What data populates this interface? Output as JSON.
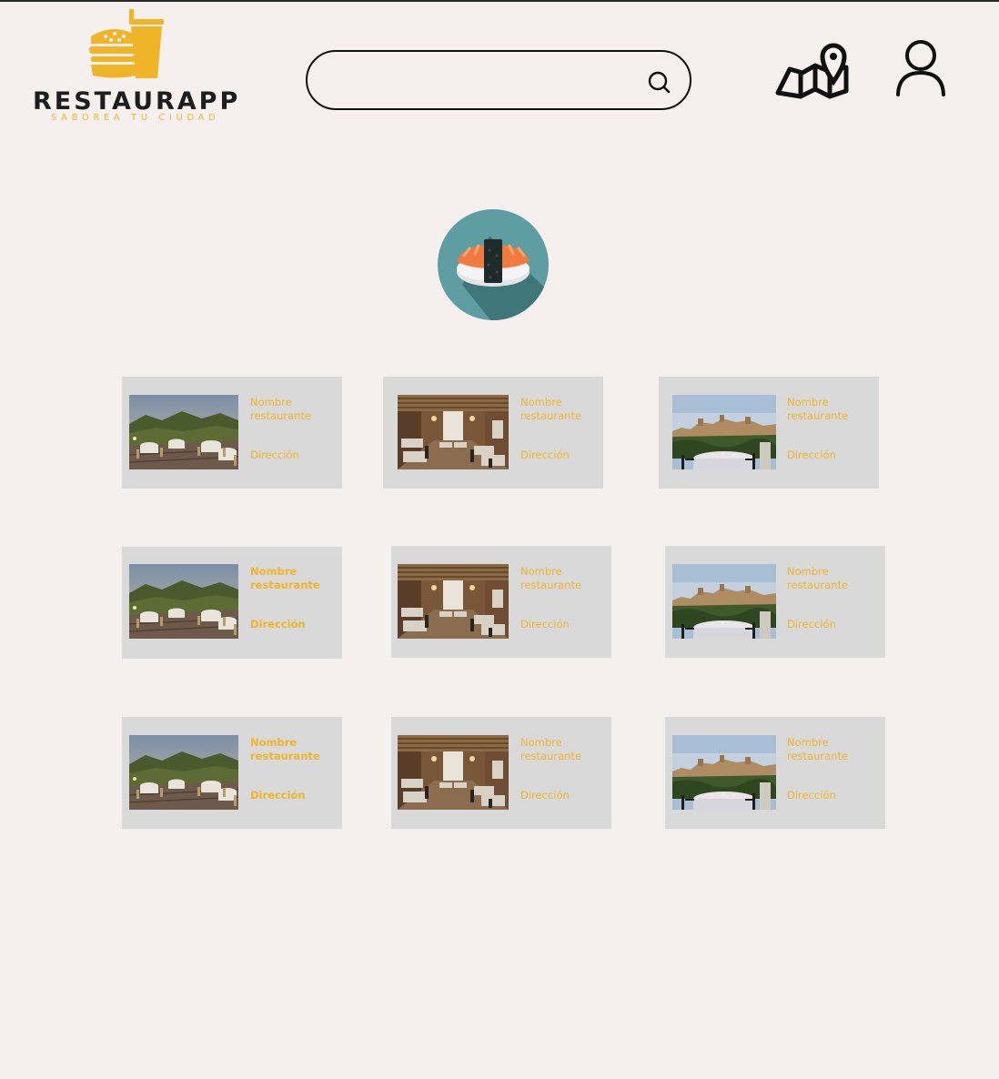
{
  "brand": {
    "name": "RESTAURAPP",
    "tagline": "SABOREA TU CIUDAD",
    "color": "#f0b429"
  },
  "search": {
    "value": "",
    "placeholder": ""
  },
  "header": {
    "map_icon": "map-pin-icon",
    "user_icon": "user-icon"
  },
  "category": {
    "icon": "sushi-icon",
    "bg_color": "#5e9ea2"
  },
  "restaurants": [
    {
      "name": "Nombre restaurante",
      "address": "Dirección",
      "photo": "terrace-photo"
    },
    {
      "name": "Nombre restaurante",
      "address": "Dirección",
      "photo": "dining-room-photo"
    },
    {
      "name": "Nombre restaurante",
      "address": "Dirección",
      "photo": "alhambra-view-photo"
    },
    {
      "name": "Nombre restaurante",
      "address": "Dirección",
      "photo": "terrace-photo"
    },
    {
      "name": "Nombre restaurante",
      "address": "Dirección",
      "photo": "dining-room-photo"
    },
    {
      "name": "Nombre restaurante",
      "address": "Dirección",
      "photo": "alhambra-view-photo"
    },
    {
      "name": "Nombre restaurante",
      "address": "Dirección",
      "photo": "terrace-photo"
    },
    {
      "name": "Nombre restaurante",
      "address": "Dirección",
      "photo": "dining-room-photo"
    },
    {
      "name": "Nombre restaurante",
      "address": "Dirección",
      "photo": "alhambra-view-photo"
    }
  ]
}
